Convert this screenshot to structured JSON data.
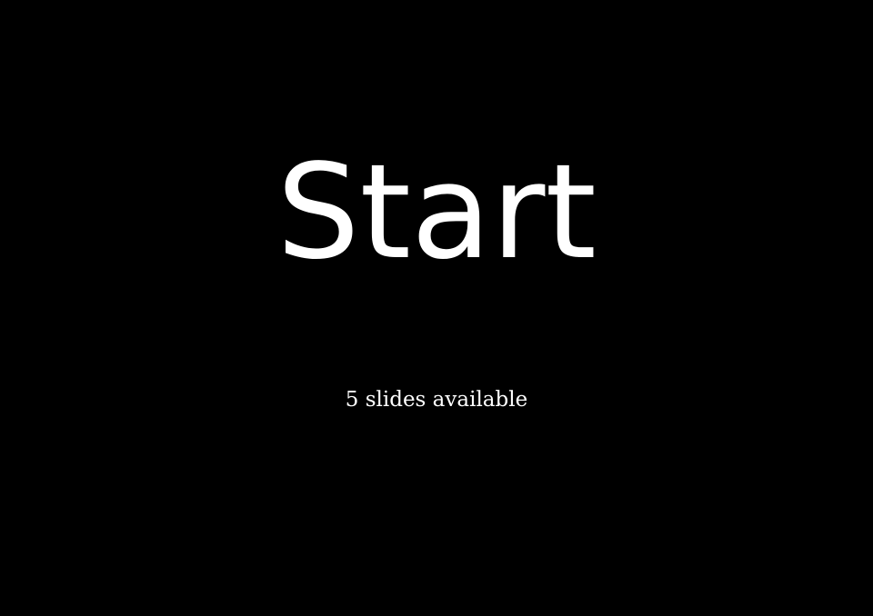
{
  "screen": {
    "start_label": "Start",
    "slide_count_text": "5 slides available",
    "background_color": "#000000",
    "text_color": "#ffffff"
  }
}
